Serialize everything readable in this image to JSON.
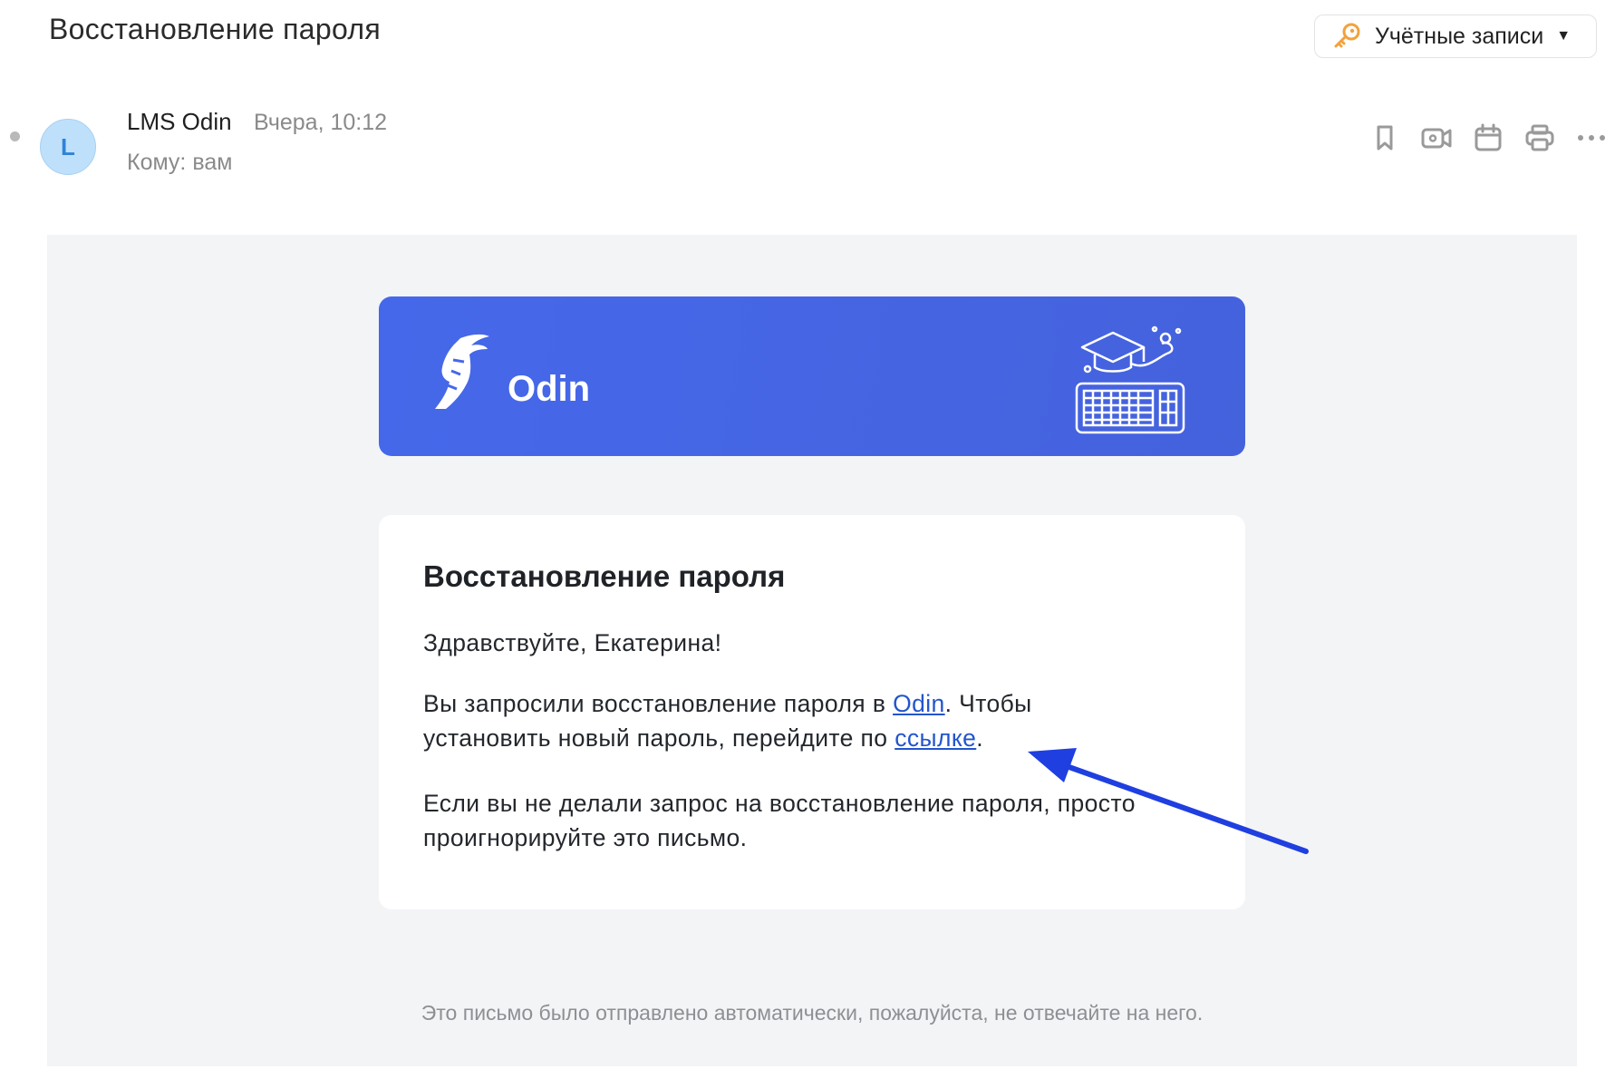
{
  "header": {
    "subject": "Восстановление пароля",
    "accounts_label": "Учётные записи",
    "accounts_icon": "key-icon"
  },
  "message": {
    "avatar_letter": "L",
    "sender": "LMS Odin",
    "date": "Вчера, 10:12",
    "recipient": "Кому: вам",
    "toolbar_icons": [
      "bookmark-icon",
      "video-call-icon",
      "calendar-icon",
      "print-icon",
      "more-icon"
    ]
  },
  "email": {
    "brand": "Odin",
    "card_title": "Восстановление пароля",
    "greeting": "Здравствуйте, Екатерина!",
    "p2_prefix": "Вы запросили восстановление пароля в ",
    "p2_link1": "Odin",
    "p2_middle": ". Чтобы установить новый пароль, перейдите по ",
    "p2_link2": "ссылке",
    "p2_suffix": ".",
    "p3": "Если вы не делали запрос на восстановление пароля, просто проигнорируйте это письмо.",
    "footer": "Это письмо было отправлено автоматически, пожалуйста, не отвечайте на него."
  },
  "colors": {
    "banner": "#4568ea",
    "link": "#2355cc",
    "annotation_arrow": "#1f3fe0",
    "avatar_bg": "#bfe0fb",
    "key_icon": "#f2a23a"
  }
}
